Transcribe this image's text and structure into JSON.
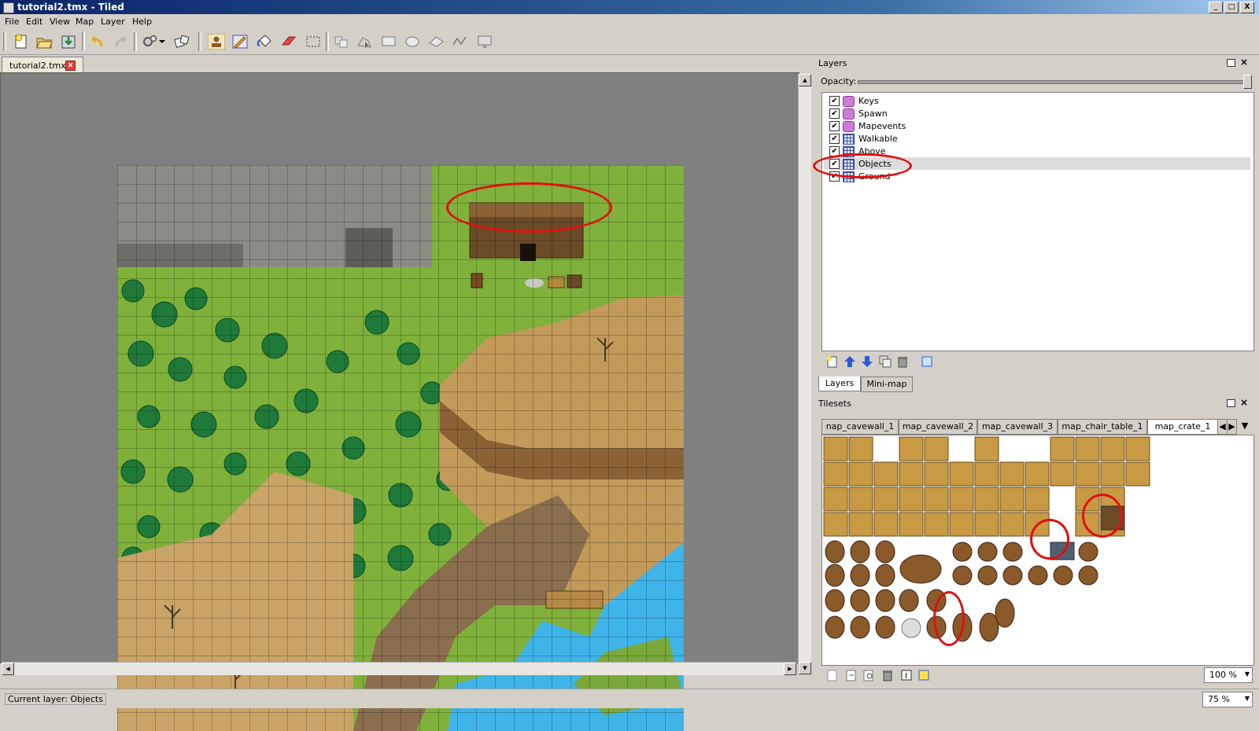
{
  "window": {
    "title": "tutorial2.tmx - Tiled",
    "controls": [
      "_",
      "□",
      "X"
    ]
  },
  "menu": [
    "File",
    "Edit",
    "View",
    "Map",
    "Layer",
    "Help"
  ],
  "toolbar": {
    "icons": [
      "new-map-icon",
      "open-icon",
      "save-icon",
      "undo-icon",
      "redo-icon",
      "command-icon",
      "random-icon",
      "stamp-brush-icon",
      "terrain-brush-icon",
      "bucket-fill-icon",
      "eraser-icon",
      "rectangle-select-icon",
      "select-objects-icon",
      "edit-polygon-icon",
      "insert-rectangle-icon",
      "insert-ellipse-icon",
      "insert-polygon-icon",
      "insert-polyline-icon",
      "insert-tile-icon"
    ],
    "colors": {
      "accent": "#2a5bd7",
      "undo": "#e8a91e",
      "eraser": "#e04848"
    }
  },
  "document": {
    "tab_label": "tutorial2.tmx",
    "close_label": "x"
  },
  "layers_panel": {
    "title": "Layers",
    "opacity_label": "Opacity:",
    "opacity_value": 1.0,
    "layers": [
      {
        "name": "Keys",
        "type": "object",
        "visible": true,
        "selected": false
      },
      {
        "name": "Spawn",
        "type": "object",
        "visible": true,
        "selected": false
      },
      {
        "name": "Mapevents",
        "type": "object",
        "visible": true,
        "selected": false
      },
      {
        "name": "Walkable",
        "type": "tile",
        "visible": true,
        "selected": false
      },
      {
        "name": "Above",
        "type": "tile",
        "visible": true,
        "selected": false
      },
      {
        "name": "Objects",
        "type": "tile",
        "visible": true,
        "selected": true
      },
      {
        "name": "Ground",
        "type": "tile",
        "visible": true,
        "selected": false
      }
    ],
    "actions": [
      "new-layer-icon",
      "move-up-icon",
      "move-down-icon",
      "duplicate-icon",
      "delete-icon",
      "properties-icon"
    ],
    "tabs": [
      "Layers",
      "Mini-map"
    ],
    "active_tab": 0
  },
  "tilesets_panel": {
    "title": "Tilesets",
    "tabs": [
      "nap_cavewall_1",
      "map_cavewall_2",
      "map_cavewall_3",
      "map_chair_table_1",
      "map_crate_1"
    ],
    "active_tab": 4,
    "nav": [
      "◀",
      "▶",
      "▼"
    ],
    "zoom": "100 %",
    "actions": [
      "new-tileset-icon",
      "import-icon",
      "export-icon",
      "delete-tileset-icon",
      "edit-terrain-icon",
      "tileset-properties-icon"
    ]
  },
  "status": {
    "label": "Current layer: Objects",
    "zoom": "75 %"
  }
}
